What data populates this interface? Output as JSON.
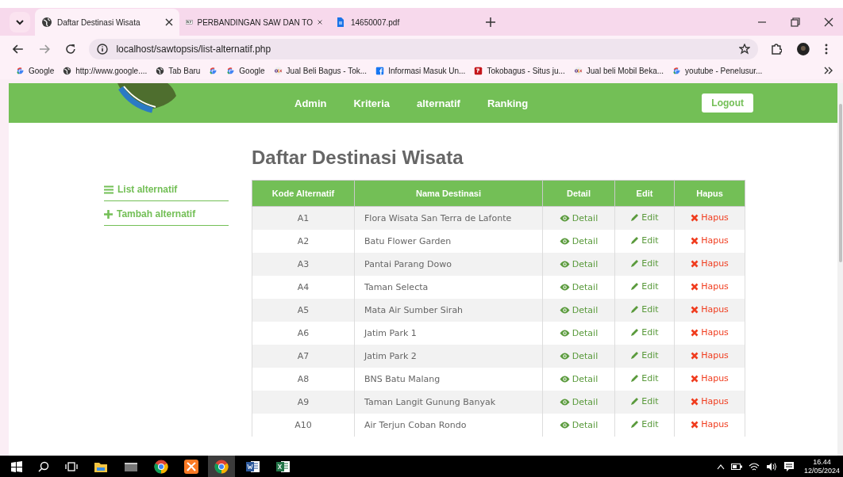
{
  "browser": {
    "tabs": [
      {
        "title": "Daftar Destinasi Wisata",
        "kind": "globe",
        "selected": true
      },
      {
        "title": "PERBANDINGAN SAW DAN TO",
        "kind": "pkp",
        "selected": false
      },
      {
        "title": "14650007.pdf",
        "kind": "file",
        "selected": false
      }
    ],
    "address": "localhost/sawtopsis/list-alternatif.php",
    "bookmarks": [
      {
        "title": "Google",
        "kind": "google"
      },
      {
        "title": "http://www.google....",
        "kind": "globe"
      },
      {
        "title": "Tab Baru",
        "kind": "globe"
      },
      {
        "kind": "google"
      },
      {
        "title": "Google",
        "kind": "google"
      },
      {
        "title": "Jual Beli Bagus - Tok...",
        "kind": "olx"
      },
      {
        "title": "Informasi Masuk Un...",
        "kind": "facebook"
      },
      {
        "title": "Tokobagus - Situs ju...",
        "kind": "toko"
      },
      {
        "title": "Jual beli Mobil Beka...",
        "kind": "olx"
      },
      {
        "title": "youtube - Penelusur...",
        "kind": "google"
      }
    ]
  },
  "nav": {
    "items": [
      {
        "label": "Admin"
      },
      {
        "label": "Kriteria"
      },
      {
        "label": "alternatif"
      },
      {
        "label": "Ranking"
      }
    ],
    "logout": "Logout"
  },
  "sidebar": {
    "items": [
      {
        "label": "List alternatif",
        "kind": "list"
      },
      {
        "label": "Tambah alternatif",
        "kind": "plus"
      }
    ]
  },
  "heading": "Daftar Destinasi Wisata",
  "table": {
    "columns": [
      "Kode Alternatif",
      "Nama Destinasi",
      "Detail",
      "Edit",
      "Hapus"
    ],
    "rows": [
      {
        "code": "A1",
        "name": "Flora Wisata San Terra de Lafonte",
        "detail": "Detail",
        "edit": "Edit",
        "delete": "Hapus"
      },
      {
        "code": "A2",
        "name": "Batu Flower Garden",
        "detail": "Detail",
        "edit": "Edit",
        "delete": "Hapus"
      },
      {
        "code": "A3",
        "name": "Pantai Parang Dowo",
        "detail": "Detail",
        "edit": "Edit",
        "delete": "Hapus"
      },
      {
        "code": "A4",
        "name": "Taman Selecta",
        "detail": "Detail",
        "edit": "Edit",
        "delete": "Hapus"
      },
      {
        "code": "A5",
        "name": "Mata Air Sumber Sirah",
        "detail": "Detail",
        "edit": "Edit",
        "delete": "Hapus"
      },
      {
        "code": "A6",
        "name": "Jatim Park 1",
        "detail": "Detail",
        "edit": "Edit",
        "delete": "Hapus"
      },
      {
        "code": "A7",
        "name": "Jatim Park 2",
        "detail": "Detail",
        "edit": "Edit",
        "delete": "Hapus"
      },
      {
        "code": "A8",
        "name": "BNS Batu Malang",
        "detail": "Detail",
        "edit": "Edit",
        "delete": "Hapus"
      },
      {
        "code": "A9",
        "name": "Taman Langit Gunung Banyak",
        "detail": "Detail",
        "edit": "Edit",
        "delete": "Hapus"
      },
      {
        "code": "A10",
        "name": "Air Terjun Coban Rondo",
        "detail": "Detail",
        "edit": "Edit",
        "delete": "Hapus"
      }
    ]
  },
  "taskbar": {
    "time": "16.44",
    "date": "12/05/2024"
  }
}
